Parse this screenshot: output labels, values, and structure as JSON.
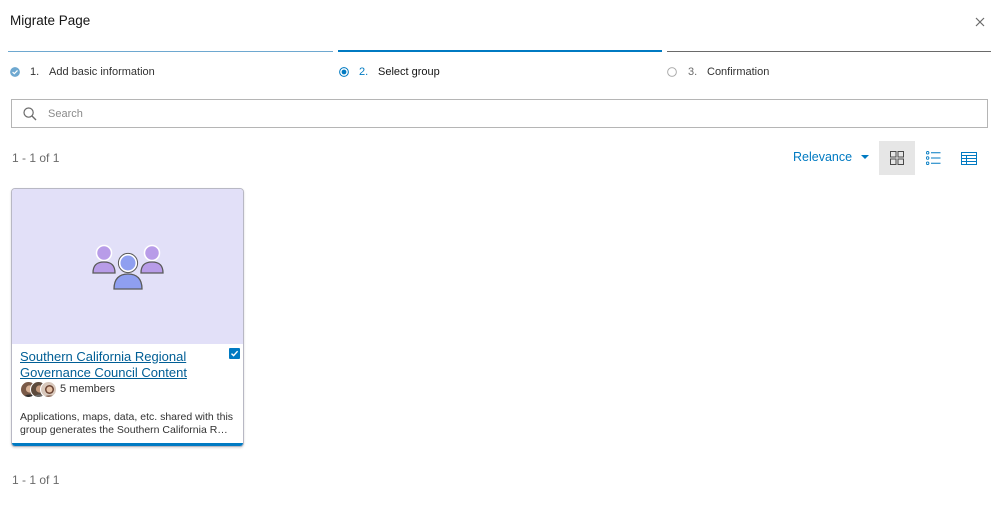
{
  "dialog": {
    "title": "Migrate Page",
    "close_icon": "close-icon"
  },
  "steps": [
    {
      "number": "1.",
      "label": "Add basic information",
      "state": "complete"
    },
    {
      "number": "2.",
      "label": "Select group",
      "state": "active"
    },
    {
      "number": "3.",
      "label": "Confirmation",
      "state": "pending"
    }
  ],
  "search": {
    "placeholder": "Search",
    "value": "",
    "icon": "search-icon"
  },
  "results": {
    "count_top": "1 - 1 of 1",
    "count_bottom": "1 - 1 of 1"
  },
  "toolbar": {
    "sort_label": "Relevance",
    "views": [
      {
        "name": "grid-view",
        "icon": "grid-icon",
        "selected": true
      },
      {
        "name": "list-view",
        "icon": "list-icon",
        "selected": false
      },
      {
        "name": "table-view",
        "icon": "table-icon",
        "selected": false
      }
    ]
  },
  "group_card": {
    "title": "Southern California Regional Governance Council Content",
    "members": "5 members",
    "description_line1": "Applications, maps, data, etc. shared with this",
    "description_line2": "group generates the Southern California Regional Governance Council Content",
    "selected": true,
    "thumbnail_icon": "group-users-icon"
  },
  "colors": {
    "accent": "#007ac2",
    "link": "#005e95",
    "thumbnail_bg": "#e2e0f8",
    "step_complete": "#6ea8d0",
    "step_pending": "#6a6a6a"
  }
}
